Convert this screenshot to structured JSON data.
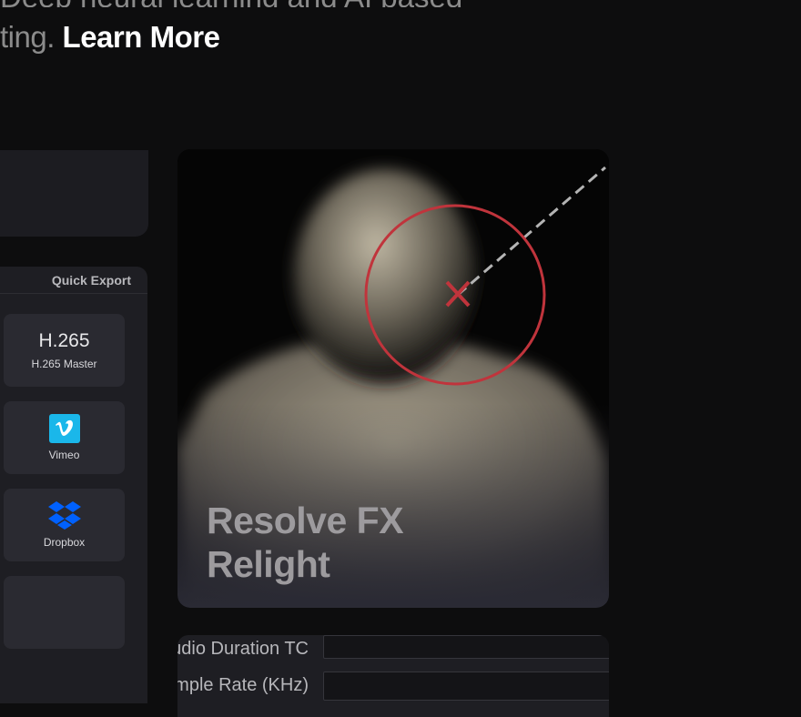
{
  "hero": {
    "top_text": "Deep neural learning and AI based",
    "text": "ting.",
    "link": "Learn More"
  },
  "export_panel": {
    "header": "Quick Export",
    "tiles": [
      {
        "title": "H.265",
        "subtitle": "H.265 Master",
        "icon": "h265-text"
      },
      {
        "title": "",
        "subtitle": "Vimeo",
        "icon": "vimeo-icon"
      },
      {
        "title": "",
        "subtitle": "Dropbox",
        "icon": "dropbox-icon"
      },
      {
        "title": "",
        "subtitle": "",
        "icon": ""
      }
    ]
  },
  "feature_card": {
    "title_line1": "Resolve FX",
    "title_line2": "Relight"
  },
  "params": {
    "rows": [
      {
        "label": "Audio Duration TC"
      },
      {
        "label": "Sample Rate (KHz)"
      }
    ]
  },
  "colors": {
    "background": "#0d0d0e",
    "panel": "#1e1e23",
    "tile": "#2a2a31",
    "vimeo": "#1ab7ea",
    "dropbox": "#0061fe",
    "relight_circle": "#c0343c"
  }
}
